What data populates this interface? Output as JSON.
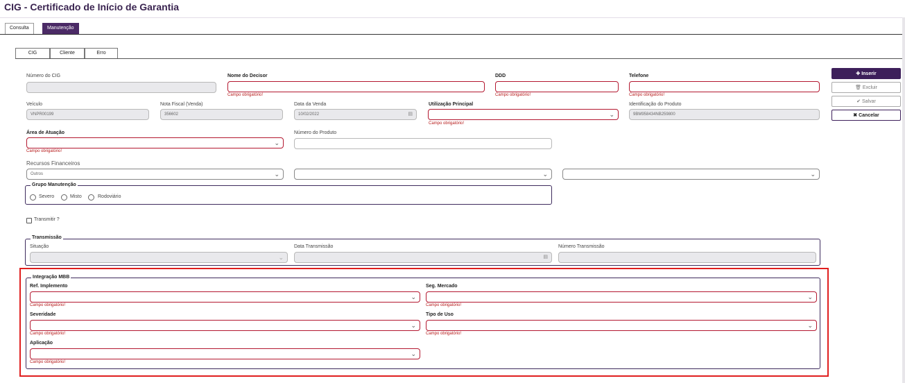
{
  "app_title": "CIG - Certificado de Início de Garantia",
  "main_tabs": [
    "Consulta",
    "Manutenção"
  ],
  "sub_tabs": [
    "CIG",
    "Cliente",
    "Erro"
  ],
  "required_msg": "Campo obrigatório!",
  "fields": {
    "numero_cig": {
      "label": "Número do CIG",
      "value": ""
    },
    "nome_decisor": {
      "label": "Nome do Decisor",
      "value": ""
    },
    "ddd": {
      "label": "DDD",
      "value": ""
    },
    "telefone": {
      "label": "Telefone",
      "value": ""
    },
    "veiculo": {
      "label": "Veículo",
      "value": "VNPR00199"
    },
    "nota_fiscal": {
      "label": "Nota Fiscal (Venda)",
      "value": "356602"
    },
    "data_venda": {
      "label": "Data da Venda",
      "value": "10/02/2022"
    },
    "utilizacao": {
      "label": "Utilização Principal",
      "value": ""
    },
    "identificacao": {
      "label": "Identificação do Produto",
      "value": "9BM958434NB259800"
    },
    "area_atuacao": {
      "label": "Área de Atuação",
      "value": ""
    },
    "numero_produto": {
      "label": "Número do Produto",
      "value": ""
    },
    "recursos": {
      "label": "Recursos Financeiros",
      "value": "Outros"
    }
  },
  "grupo_manutencao": {
    "legend": "Grupo Manutenção",
    "options": [
      "Severo",
      "Misto",
      "Rodoviário"
    ]
  },
  "transmitir_label": "Transmitir ?",
  "transmissao": {
    "legend": "Transmissão",
    "situacao": "Situação",
    "data": "Data Transmissão",
    "numero": "Número Transmissão"
  },
  "integracao": {
    "legend": "Integração MBB",
    "ref_implemento": "Ref. Implemento",
    "seg_mercado": "Seg. Mercado",
    "severidade": "Severidade",
    "tipo_uso": "Tipo de Uso",
    "aplicacao": "Aplicação"
  },
  "buttons": {
    "inserir": "Inserir",
    "excluir": "Excluir",
    "salvar": "Salvar",
    "cancelar": "Cancelar"
  },
  "icons": [
    "plus-icon",
    "trash-icon",
    "check-icon",
    "x-icon",
    "chevron-down-icon",
    "calendar-icon"
  ],
  "colors": {
    "brand": "#3d1f5a",
    "error": "#b3172f",
    "highlight": "#e01e1e"
  }
}
